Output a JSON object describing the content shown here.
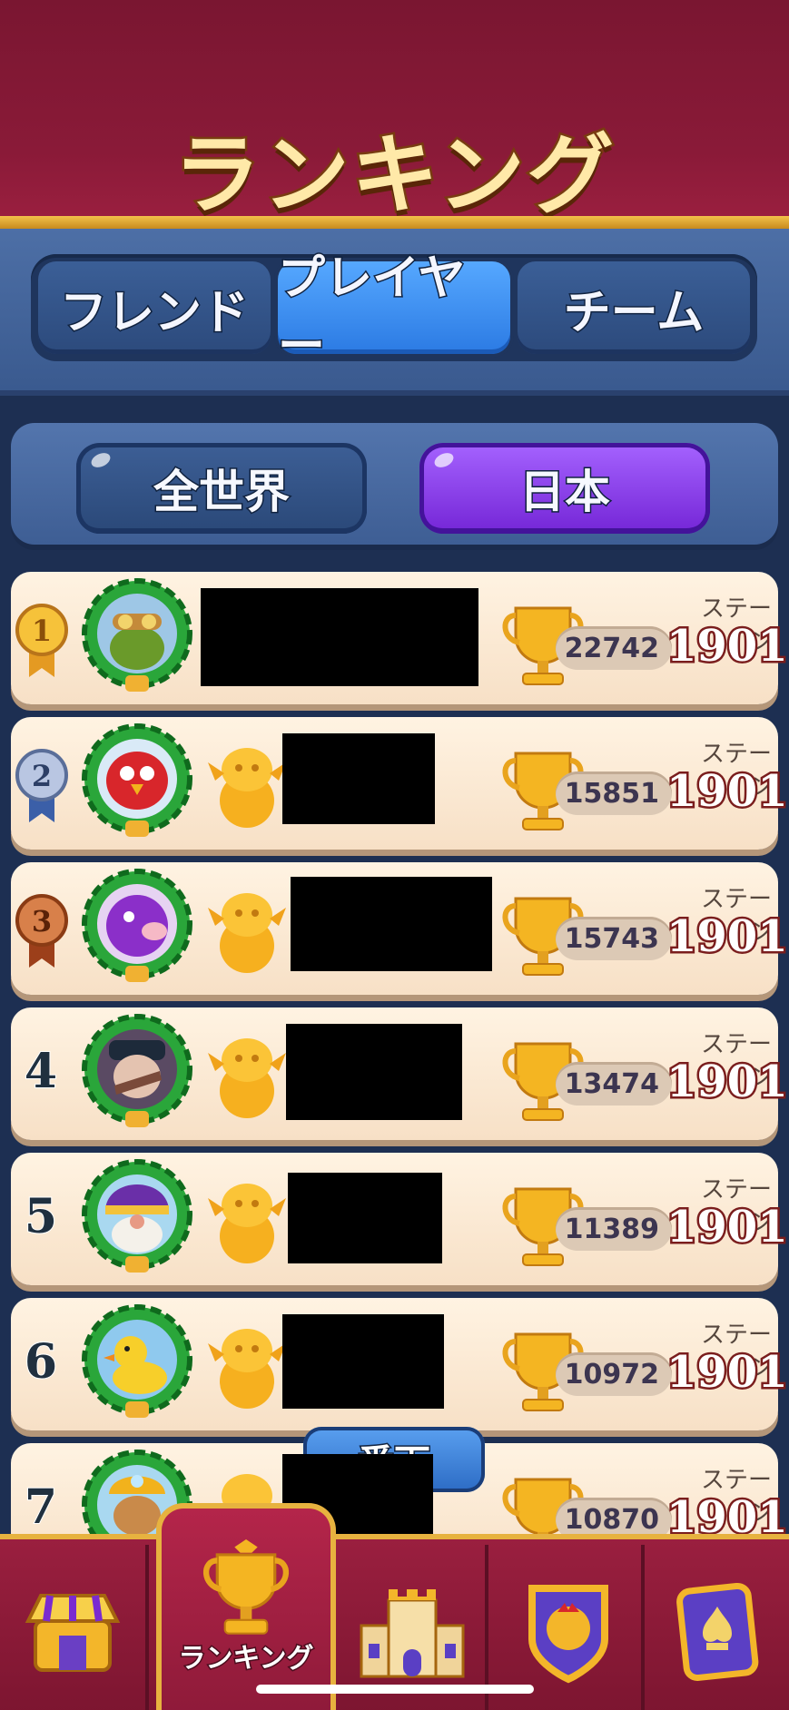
{
  "header": {
    "title": "ランキング"
  },
  "tabs": [
    {
      "label": "フレンド",
      "active": false
    },
    {
      "label": "プレイヤー",
      "active": true
    },
    {
      "label": "チーム",
      "active": false
    }
  ],
  "region": {
    "world_label": "全世界",
    "japan_label": "日本",
    "selected": "日本"
  },
  "rows": [
    {
      "rank": "1",
      "score": "22742",
      "stage_label": "ステージ",
      "stage": "1901",
      "avatar": "goggles-frog-avatar"
    },
    {
      "rank": "2",
      "score": "15851",
      "stage_label": "ステージ",
      "stage": "1901",
      "avatar": "red-bird-avatar"
    },
    {
      "rank": "3",
      "score": "15743",
      "stage_label": "ステージ",
      "stage": "1901",
      "avatar": "purple-pig-avatar"
    },
    {
      "rank": "4",
      "score": "13474",
      "stage_label": "ステージ",
      "stage": "1901",
      "avatar": "portrait-avatar"
    },
    {
      "rank": "5",
      "score": "11389",
      "stage_label": "ステージ",
      "stage": "1901",
      "avatar": "gnome-avatar"
    },
    {
      "rank": "6",
      "score": "10972",
      "stage_label": "ステージ",
      "stage": "1901",
      "avatar": "duck-avatar"
    },
    {
      "rank": "7",
      "score": "10870",
      "stage_label": "ステージ",
      "stage": "1901",
      "avatar": "miner-avatar"
    }
  ],
  "jump_button": {
    "label": "番下"
  },
  "nav": {
    "items": [
      {
        "name": "shop",
        "icon": "shop-icon"
      },
      {
        "name": "ranking",
        "icon": "trophy-icon",
        "label": "ランキング",
        "active": true
      },
      {
        "name": "castle",
        "icon": "castle-icon"
      },
      {
        "name": "team",
        "icon": "team-shield-icon"
      },
      {
        "name": "collection",
        "icon": "card-icon"
      }
    ]
  },
  "colors": {
    "header": "#8a1a38",
    "accent_gold": "#e7b23f",
    "tab_active": "#2b7ae3",
    "japan_button": "#7425d6",
    "row_bg": "#fff3e2"
  }
}
